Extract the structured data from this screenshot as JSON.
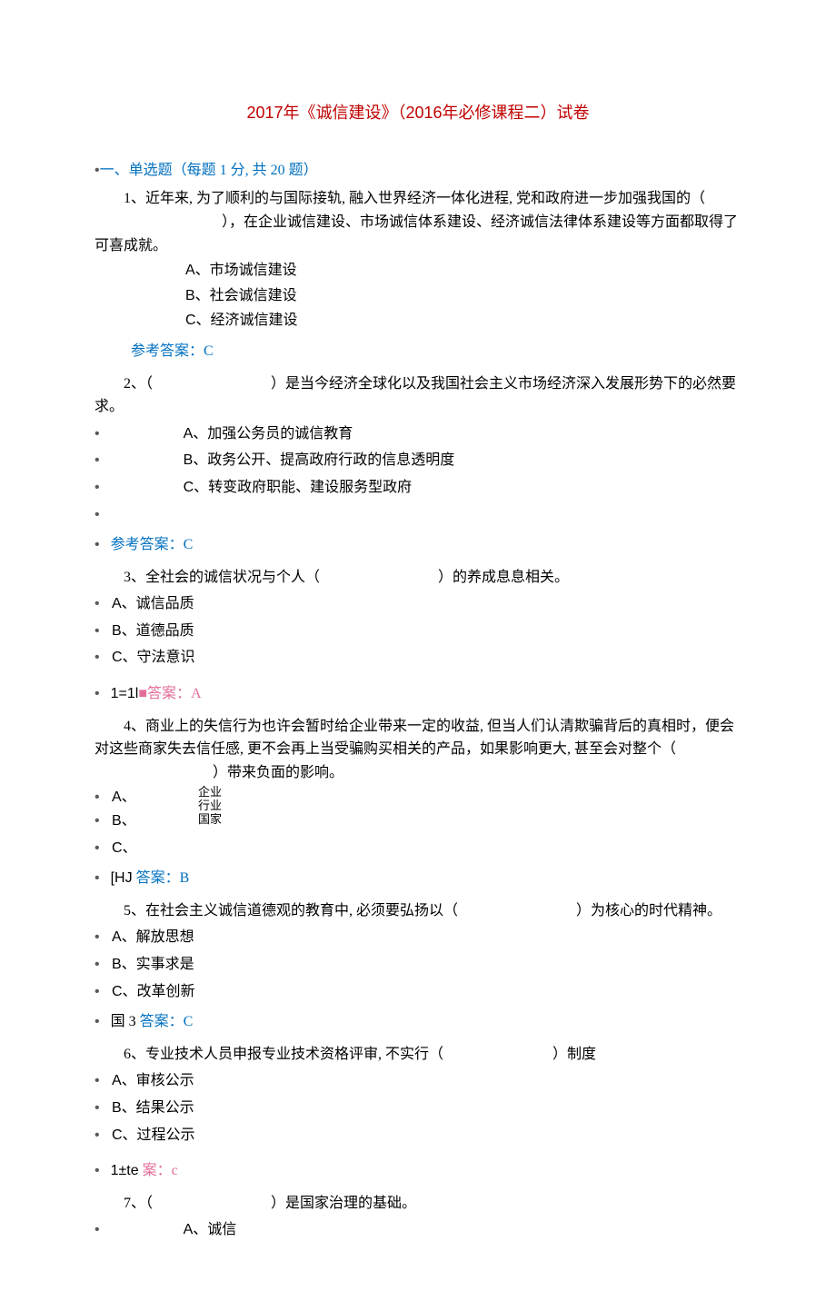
{
  "title": "2017年《诚信建设》（2016年必修课程二）试卷",
  "section1Header": "一、单选题（每题 1 分, 共 20 题）",
  "q1": {
    "text": "1、近年来, 为了顺利的与国际接轨, 融入世界经济一体化进程, 党和政府进一步加强我国的（",
    "blank": "",
    "text2": "），在企业诚信建设、市场诚信体系建设、经济诚信法律体系建设等方面都取得了可喜成就。",
    "A": "A、市场诚信建设",
    "B": "B、社会诚信建设",
    "C": "C、经济诚信建设",
    "answerLabel": "参考答案：",
    "answerVal": "C"
  },
  "q2": {
    "text": "2、（",
    "text2": "）是当今经济全球化以及我国社会主义市场经济深入发展形势下的必然要求。",
    "A": "A、加强公务员的诚信教育",
    "B": "B、政务公开、提高政府行政的信息透明度",
    "C": "C、转变政府职能、建设服务型政府",
    "answerLabel": "参考答案：",
    "answerVal": "C"
  },
  "q3": {
    "text": "3、全社会的诚信状况与个人（",
    "text2": "）的养成息息相关。",
    "A": "A、诚信品质",
    "B": "B、道德品质",
    "C": "C、守法意识",
    "answerPrefix": "1=1l",
    "answerGlyph": "■",
    "answerLabel": "答案：",
    "answerVal": "A"
  },
  "q4": {
    "text": "4、商业上的失信行为也许会暂时给企业带来一定的收益, 但当人们认清欺骗背后的真相时，便会对这些商家失去信任感, 更不会再上当受骗购买相关的产品，如果影响更大, 甚至会对整个（",
    "text2": "）带来负面的影响。",
    "A": "A、",
    "B": "B、",
    "C": "C、",
    "r1": "企业",
    "r2": "行业",
    "r3": "国家",
    "answerPrefix": "[HJ",
    "answerLabel": "答案：",
    "answerVal": "B"
  },
  "q5": {
    "text": "5、在社会主义诚信道德观的教育中, 必须要弘扬以（",
    "text2": "）为核心的时代精神。",
    "A": "A、解放思想",
    "B": "B、实事求是",
    "C": "C、改革创新",
    "answerPrefix": "国 3",
    "answerLabel": "答案：",
    "answerVal": "C"
  },
  "q6": {
    "text": "6、专业技术人员申报专业技术资格评审, 不实行（",
    "text2": "）制度",
    "A": "A、审核公示",
    "B": "B、结果公示",
    "C": "C、过程公示",
    "answerPrefix": "1±te",
    "answerLabel": "案：",
    "answerVal": "c"
  },
  "q7": {
    "text": "7、（",
    "text2": "）是国家治理的基础。",
    "A": "A、诚信"
  }
}
